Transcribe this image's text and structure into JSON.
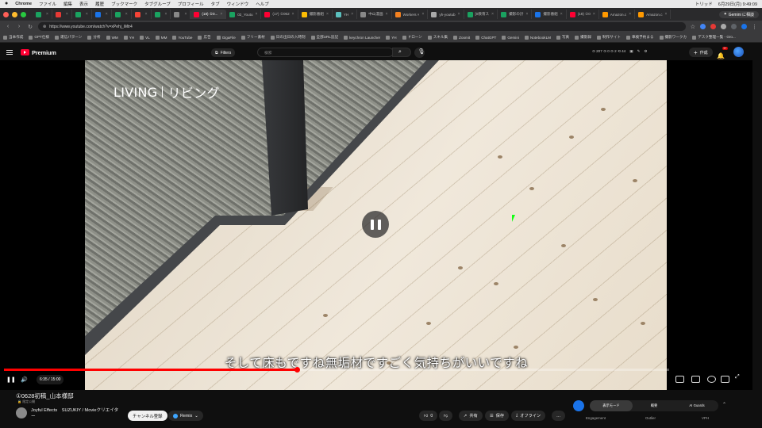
{
  "mac_menu": {
    "app": "Chrome",
    "items": [
      "ファイル",
      "編集",
      "表示",
      "履歴",
      "ブックマーク",
      "タブグループ",
      "プロフィール",
      "タブ",
      "ウィンドウ",
      "ヘルプ"
    ],
    "clock": "6月29日(月) 9:49:09",
    "user": "トリッド"
  },
  "tabs": [
    {
      "label": "",
      "color": "#1aa260"
    },
    {
      "label": "",
      "color": "#e53935"
    },
    {
      "label": "",
      "color": "#1aa260"
    },
    {
      "label": "",
      "color": "#1a73e8"
    },
    {
      "label": "",
      "color": "#1aa260"
    },
    {
      "label": "",
      "color": "#f44336"
    },
    {
      "label": "",
      "color": "#1aa260"
    },
    {
      "label": "",
      "color": "#888"
    },
    {
      "label": "(18) ①0... ",
      "color": "#ff0033",
      "active": true
    },
    {
      "label": "02_Youtu",
      "color": "#1aa260"
    },
    {
      "label": "(17) ①062",
      "color": "#ff0033"
    },
    {
      "label": "撮影番組",
      "color": "#fbbc04"
    },
    {
      "label": "YH",
      "color": "#5bc0be"
    },
    {
      "label": "中山漫画",
      "color": "#888"
    },
    {
      "label": "Workers ×",
      "color": "#f48120"
    },
    {
      "label": "yh-youtub",
      "color": "#aaa"
    },
    {
      "label": "[0教育ス",
      "color": "#1aa260"
    },
    {
      "label": "撮影の計",
      "color": "#1aa260"
    },
    {
      "label": "撮影番組",
      "color": "#1a73e8"
    },
    {
      "label": "(18) ①0",
      "color": "#ff0033"
    },
    {
      "label": "Amazon.c",
      "color": "#ff9900"
    },
    {
      "label": "Amazon.c",
      "color": "#ff9900"
    }
  ],
  "gemini_label": "Gemini に相談",
  "url": "https://www.youtube.com/watch?v=xPehj_iMtr4",
  "bookmarks": [
    "当本作成",
    "GPT仕様",
    "運信パターン",
    "分析",
    "WM",
    "YH",
    "VL",
    "MM",
    "YouTube",
    "広告",
    "GigaFile",
    "フリー素材",
    "日の出日の入時刻",
    "全部URL追記",
    "keychron Launcher",
    "YH",
    "ドローン",
    "スキル集",
    "Zoomit",
    "ChatGPT",
    "Gemini",
    "NotebookLM",
    "写真",
    "撮影録",
    "制作サイト",
    "車検予約まる",
    "撮影ワークカ",
    "デスク整理一覧 - Gro..."
  ],
  "yt": {
    "logo": "Premium",
    "filters": "Filters",
    "search_placeholder": "検索",
    "ext_counts": "⊙ 207  ⊙ 0  ⊙ 2  ⟲ 44",
    "create": "作成",
    "notif_badge": "9+"
  },
  "video": {
    "living_en": "LIVING",
    "living_jp": "リビング",
    "subtitle": "そして床もですね無垢材ですごく気持ちがいいですね",
    "time": "6:35 / 15:00",
    "progress": 0.44
  },
  "info": {
    "title": "①0628初稿_山本様邸",
    "meta": "🔒 限定公開",
    "channel": "Joyful Effects　SUZUKIY / Movieクリエイター",
    "subscribe": "チャンネル登録",
    "remix": "Remix",
    "likes": "0",
    "share": "共有",
    "save": "保存",
    "offline": "オフライン",
    "more": "…"
  },
  "ext_panel": {
    "segments": [
      "表示モード",
      "概要",
      "AI Guards"
    ],
    "labels": [
      "Engagement",
      "Outlier",
      "VPH"
    ]
  }
}
